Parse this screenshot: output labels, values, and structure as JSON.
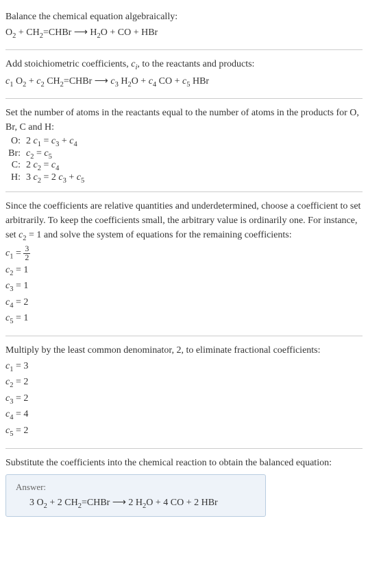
{
  "step1": {
    "text": "Balance the chemical equation algebraically:",
    "equation_html": "O<sub>2</sub> + CH<sub>2</sub>=CHBr ⟶ H<sub>2</sub>O + CO + HBr"
  },
  "step2": {
    "text_html": "Add stoichiometric coefficients, <span class='italic'>c<sub>i</sub></span>, to the reactants and products:",
    "equation_html": "<span class='italic'>c</span><sub>1</sub> O<sub>2</sub> + <span class='italic'>c</span><sub>2</sub> CH<sub>2</sub>=CHBr ⟶ <span class='italic'>c</span><sub>3</sub> H<sub>2</sub>O + <span class='italic'>c</span><sub>4</sub> CO + <span class='italic'>c</span><sub>5</sub> HBr"
  },
  "step3": {
    "text": "Set the number of atoms in the reactants equal to the number of atoms in the products for O, Br, C and H:",
    "rows": [
      {
        "label": "O:",
        "eq_html": "2 <span class='italic'>c</span><sub>1</sub> = <span class='italic'>c</span><sub>3</sub> + <span class='italic'>c</span><sub>4</sub>"
      },
      {
        "label": "Br:",
        "eq_html": "<span class='italic'>c</span><sub>2</sub> = <span class='italic'>c</span><sub>5</sub>"
      },
      {
        "label": "C:",
        "eq_html": "2 <span class='italic'>c</span><sub>2</sub> = <span class='italic'>c</span><sub>4</sub>"
      },
      {
        "label": "H:",
        "eq_html": "3 <span class='italic'>c</span><sub>2</sub> = 2 <span class='italic'>c</span><sub>3</sub> + <span class='italic'>c</span><sub>5</sub>"
      }
    ]
  },
  "step4": {
    "text_html": "Since the coefficients are relative quantities and underdetermined, choose a coefficient to set arbitrarily. To keep the coefficients small, the arbitrary value is ordinarily one. For instance, set <span class='italic'>c</span><sub>2</sub> = 1 and solve the system of equations for the remaining coefficients:",
    "coeffs_html": [
      "<span class='italic'>c</span><sub>1</sub> = <span class='frac'><span class='num'>3</span><span class='den'>2</span></span>",
      "<span class='italic'>c</span><sub>2</sub> = 1",
      "<span class='italic'>c</span><sub>3</sub> = 1",
      "<span class='italic'>c</span><sub>4</sub> = 2",
      "<span class='italic'>c</span><sub>5</sub> = 1"
    ]
  },
  "step5": {
    "text": "Multiply by the least common denominator, 2, to eliminate fractional coefficients:",
    "coeffs_html": [
      "<span class='italic'>c</span><sub>1</sub> = 3",
      "<span class='italic'>c</span><sub>2</sub> = 2",
      "<span class='italic'>c</span><sub>3</sub> = 2",
      "<span class='italic'>c</span><sub>4</sub> = 4",
      "<span class='italic'>c</span><sub>5</sub> = 2"
    ]
  },
  "step6": {
    "text": "Substitute the coefficients into the chemical reaction to obtain the balanced equation:"
  },
  "answer": {
    "label": "Answer:",
    "equation_html": "3 O<sub>2</sub> + 2 CH<sub>2</sub>=CHBr ⟶ 2 H<sub>2</sub>O + 4 CO + 2 HBr"
  }
}
